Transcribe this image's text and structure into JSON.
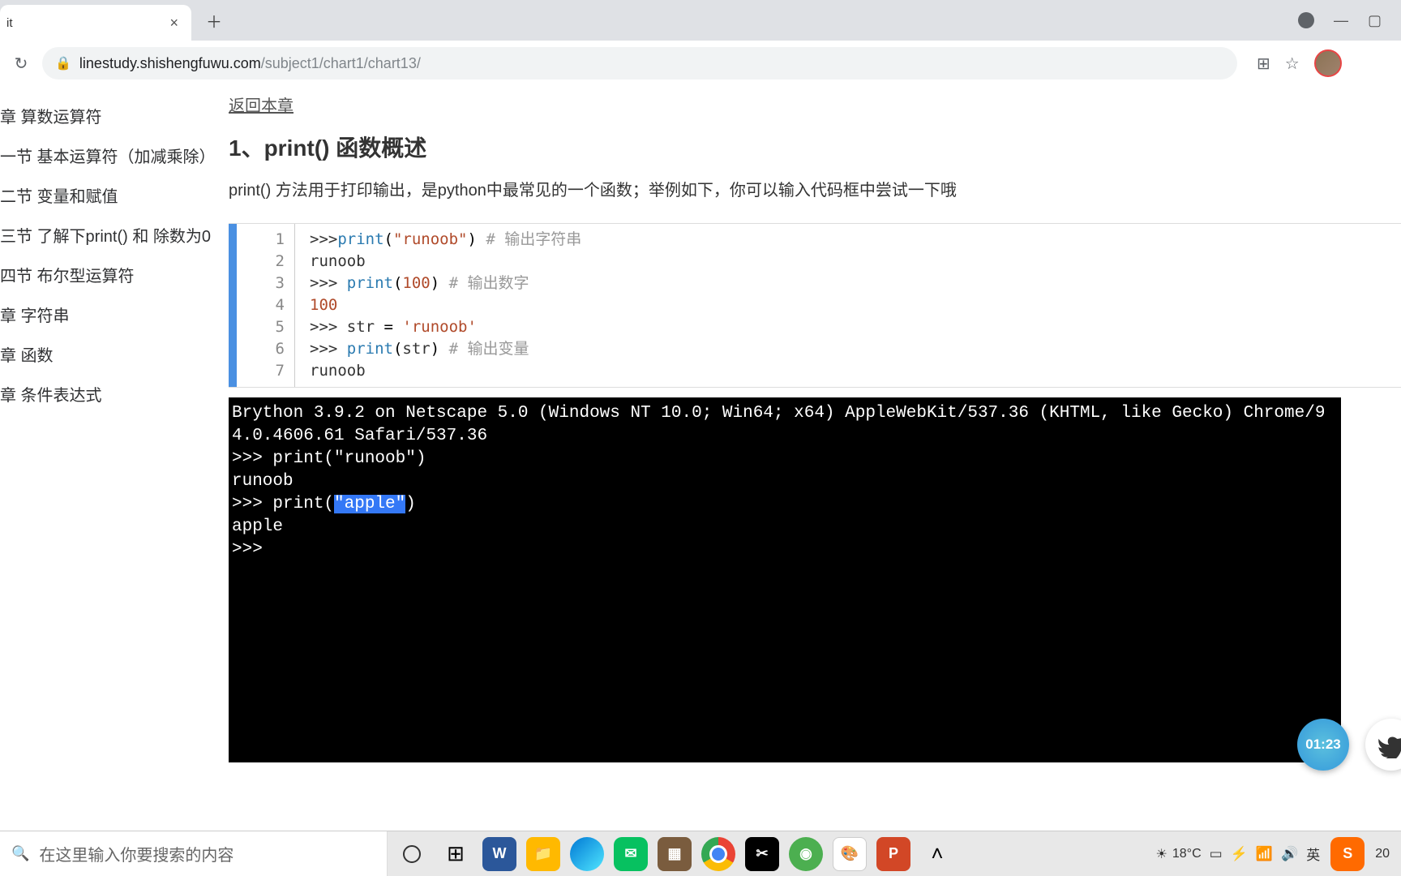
{
  "browser": {
    "tab_title": "it",
    "url_domain": "linestudy.shishengfuwu.com",
    "url_path": "/subject1/chart1/chart13/"
  },
  "sidebar": {
    "items": [
      "章 算数运算符",
      "一节 基本运算符（加减乘除）",
      "二节 变量和赋值",
      "三节 了解下print() 和 除数为0",
      "四节 布尔型运算符",
      "章 字符串",
      "章 函数",
      "章 条件表达式"
    ]
  },
  "page": {
    "back_link": "返回本章",
    "title": "1、print() 函数概述",
    "description": "print() 方法用于打印输出，是python中最常见的一个函数；举例如下，你可以输入代码框中尝试一下哦"
  },
  "editor": {
    "line_numbers": [
      "1",
      "2",
      "3",
      "4",
      "5",
      "6",
      "7"
    ],
    "lines": [
      {
        "segments": [
          {
            "t": ">>>",
            "c": "tok-prompt"
          },
          {
            "t": "print",
            "c": "tok-func"
          },
          {
            "t": "(",
            "c": ""
          },
          {
            "t": "\"runoob\"",
            "c": "tok-str"
          },
          {
            "t": ") ",
            "c": ""
          },
          {
            "t": "# 输出字符串",
            "c": "tok-comment"
          }
        ]
      },
      {
        "segments": [
          {
            "t": "runoob",
            "c": "tok-out"
          }
        ]
      },
      {
        "segments": [
          {
            "t": ">>> ",
            "c": "tok-prompt"
          },
          {
            "t": "print",
            "c": "tok-func"
          },
          {
            "t": "(",
            "c": ""
          },
          {
            "t": "100",
            "c": "tok-num"
          },
          {
            "t": ") ",
            "c": ""
          },
          {
            "t": "# 输出数字",
            "c": "tok-comment"
          }
        ]
      },
      {
        "segments": [
          {
            "t": "100",
            "c": "tok-num"
          }
        ]
      },
      {
        "segments": [
          {
            "t": ">>> ",
            "c": "tok-prompt"
          },
          {
            "t": "str",
            "c": "tok-kw"
          },
          {
            "t": " = ",
            "c": ""
          },
          {
            "t": "'runoob'",
            "c": "tok-str"
          }
        ]
      },
      {
        "segments": [
          {
            "t": ">>> ",
            "c": "tok-prompt"
          },
          {
            "t": "print",
            "c": "tok-func"
          },
          {
            "t": "(",
            "c": ""
          },
          {
            "t": "str",
            "c": "tok-kw"
          },
          {
            "t": ") ",
            "c": ""
          },
          {
            "t": "# 输出变量",
            "c": "tok-comment"
          }
        ]
      },
      {
        "segments": [
          {
            "t": "runoob",
            "c": "tok-out"
          }
        ]
      }
    ]
  },
  "terminal": {
    "header": "Brython 3.9.2 on Netscape 5.0 (Windows NT 10.0; Win64; x64) AppleWebKit/537.36 (KHTML, like Gecko) Chrome/94.0.4606.61 Safari/537.36",
    "lines": [
      ">>> print(\"runoob\")",
      "runoob"
    ],
    "sel_line_pre": ">>> print(",
    "sel_line_sel": "\"apple\"",
    "sel_line_post": ")",
    "out2": "apple",
    "prompt": ">>> "
  },
  "timer": "01:23",
  "taskbar": {
    "search_placeholder": "在这里输入你要搜索的内容",
    "weather_temp": "18°C",
    "ime": "英",
    "time": "20"
  }
}
